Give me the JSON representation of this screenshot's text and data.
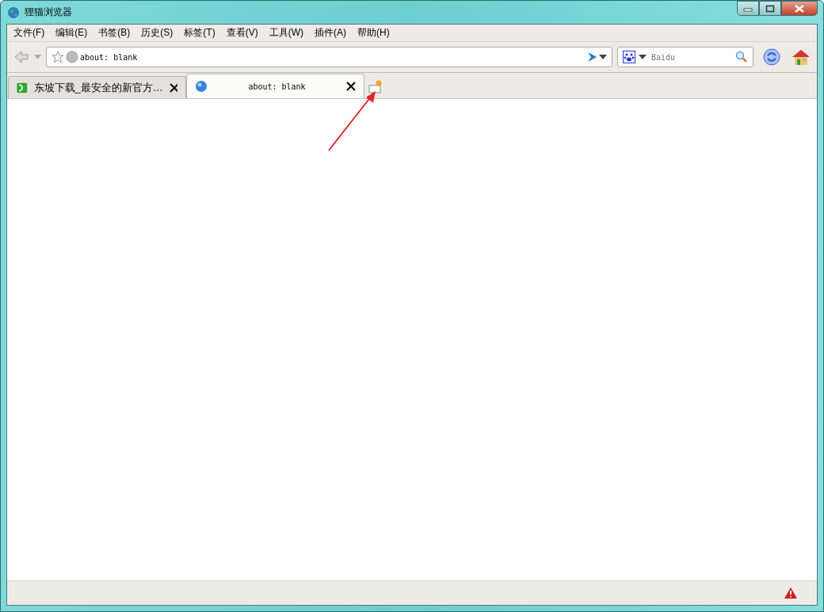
{
  "window": {
    "title": "狸猫浏览器"
  },
  "menu": [
    "文件(F)",
    "编辑(E)",
    "书签(B)",
    "历史(S)",
    "标签(T)",
    "查看(V)",
    "工具(W)",
    "插件(A)",
    "帮助(H)"
  ],
  "address_bar": {
    "value": "about: blank"
  },
  "search": {
    "placeholder": "Baidu"
  },
  "tabs": [
    {
      "label": "东坡下载_最安全的新官方…",
      "selected": false,
      "kind": "site"
    },
    {
      "label": "about: blank",
      "selected": true,
      "kind": "blank"
    }
  ]
}
